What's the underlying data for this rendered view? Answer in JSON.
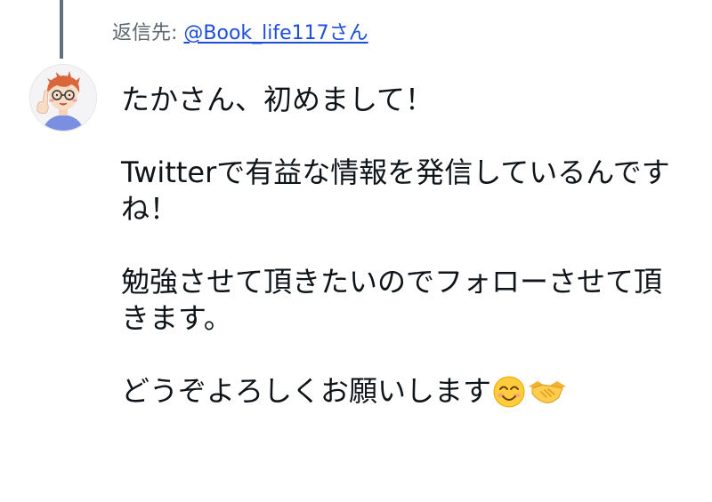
{
  "reply": {
    "prefix": "返信先: ",
    "handle": "@Book_life117さん"
  },
  "avatar": {
    "icon": "user-avatar-illustration"
  },
  "tweet": {
    "para1": "たかさん、初めまして！",
    "para2": "Twitterで有益な情報を発信しているんですね！",
    "para3": "勉強させて頂きたいのでフォローさせて頂きます。",
    "para4": "どうぞよろしくお願いします",
    "emojis": [
      "smiling-face-emoji",
      "handshake-emoji"
    ]
  },
  "colors": {
    "thread_line": "#60707d",
    "link": "#1d4ed8",
    "muted_text": "#5b6770",
    "text": "#0f1419"
  }
}
